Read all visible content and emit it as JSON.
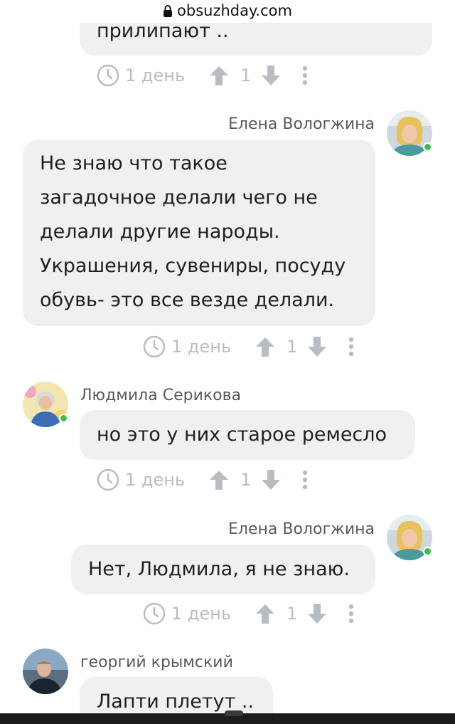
{
  "browser": {
    "url": "obsuzhday.com"
  },
  "comments": [
    {
      "author": "",
      "text": "прилипают ..",
      "time": "1 день",
      "votes": "1"
    },
    {
      "author": "Елена Вологжина",
      "text": "Не знаю что такое\nзагадочное делали чего не\nделали другие народы.\nУкрашения, сувениры, посуду\nобувь- это все везде делали.",
      "time": "1 день",
      "votes": "1"
    },
    {
      "author": "Людмила Серикова",
      "text": "но это у них старое ремесло",
      "time": "1 день",
      "votes": "1"
    },
    {
      "author": "Елена Вологжина",
      "text": "Нет, Людмила, я не знаю.",
      "time": "1 день",
      "votes": "1"
    },
    {
      "author": "георгий крымский",
      "text": "Лапти плетут ..",
      "time": "",
      "votes": ""
    }
  ],
  "colors": {
    "bubble": "#eff0f2",
    "icon": "#b8bcc3",
    "online": "#3cbf50"
  },
  "icons": [
    "lock-icon",
    "clock-icon",
    "arrow-up-icon",
    "arrow-down-icon",
    "more-vertical-icon"
  ]
}
